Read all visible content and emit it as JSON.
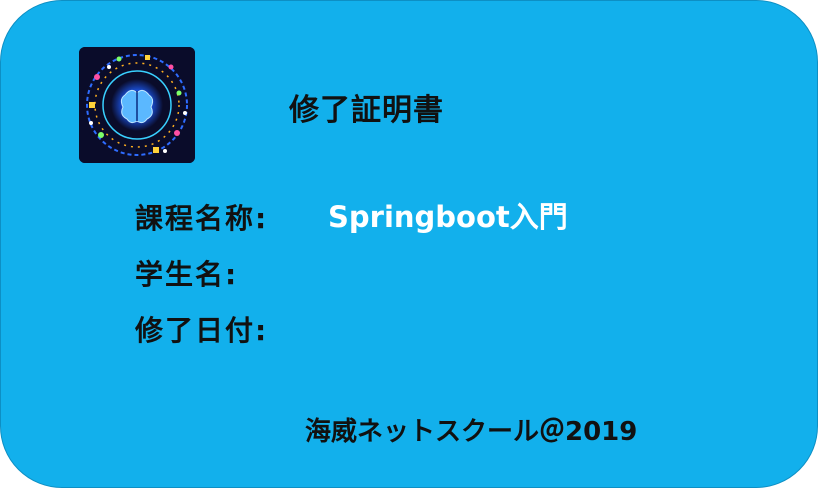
{
  "certificate": {
    "title": "修了証明書",
    "course_label": "課程名称:",
    "course_value": "Springboot入門",
    "student_label": "学生名:",
    "completion_date_label": "修了日付:",
    "footer": "海威ネットスクール＠2019"
  },
  "logo": {
    "icon": "brain-network-icon"
  },
  "colors": {
    "card_background": "#12b0ec",
    "label_text": "#111111",
    "value_text": "#ffffff",
    "logo_background": "#0a0c2a"
  }
}
